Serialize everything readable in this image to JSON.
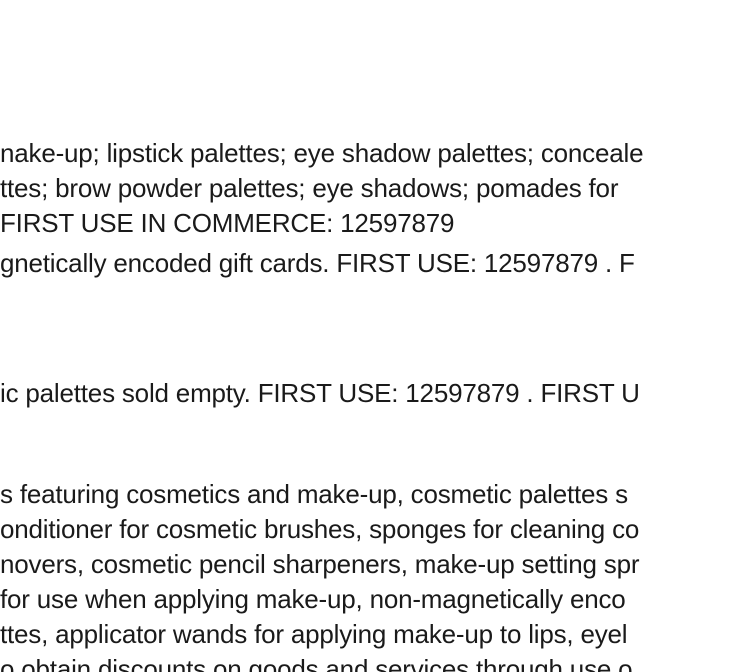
{
  "document": {
    "lines": [
      "nake-up; lipstick palettes; eye shadow palettes; conceale",
      "ttes; brow powder palettes; eye shadows; pomades for",
      " FIRST USE IN COMMERCE: 12597879",
      "gnetically encoded gift cards. FIRST USE: 12597879 . F",
      "ic palettes sold empty. FIRST USE: 12597879 . FIRST U",
      "s featuring cosmetics and make-up, cosmetic palettes s",
      "onditioner for cosmetic brushes, sponges for cleaning co",
      "novers, cosmetic pencil sharpeners, make-up setting spr",
      " for use when applying make-up, non-magnetically enco",
      "ttes, applicator wands for applying make-up to lips, eyel",
      "o obtain discounts on goods and services through use o"
    ]
  }
}
